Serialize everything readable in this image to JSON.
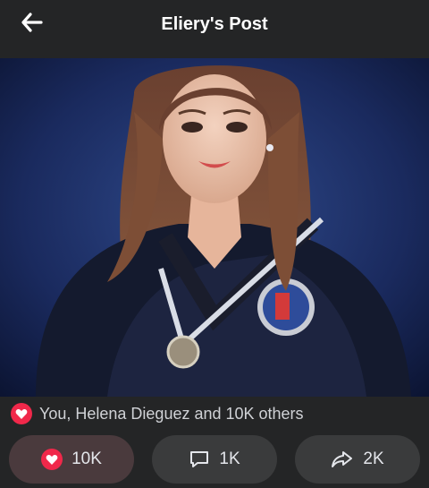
{
  "header": {
    "title": "Eliery's Post",
    "back_icon": "arrow-left-icon"
  },
  "post": {
    "image_alt": "Graduation portrait photo",
    "reactions_summary": "You, Helena Dieguez and 10K others",
    "reaction_icon": "heart-icon"
  },
  "actions": {
    "like_count": "10K",
    "comment_count": "1K",
    "share_count": "2K"
  },
  "colors": {
    "background": "#242526",
    "button": "#3a3b3c",
    "heart": "#f0284a"
  }
}
